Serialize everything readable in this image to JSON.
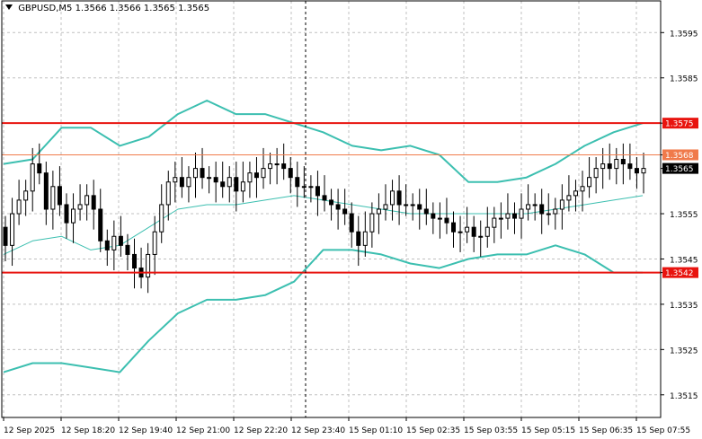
{
  "header": {
    "symbol": "GBPUSD,M5",
    "ohlc": "1.3566 1.3566 1.3565 1.3565"
  },
  "colors": {
    "background": "#ffffff",
    "grid": "#c0c0c0",
    "candle": "#000000",
    "band": "#3cbfb0",
    "level_red": "#e8130e",
    "level_orange": "#f07a4a",
    "price_label_bg": "#000000"
  },
  "icons": {
    "symbol_arrow": "triangle-down-icon"
  },
  "chart_data": {
    "type": "candlestick",
    "title": "GBPUSD,M5",
    "xlabel": "",
    "ylabel": "",
    "ylim": [
      1.351,
      1.3602
    ],
    "grid": true,
    "y_ticks": [
      "1.3595",
      "1.3585",
      "1.3575",
      "1.3568",
      "1.3565",
      "1.3555",
      "1.3545",
      "1.3542",
      "1.3535",
      "1.3525",
      "1.3515"
    ],
    "x_ticks": [
      "12 Sep 2025",
      "12 Sep 18:20",
      "12 Sep 19:40",
      "12 Sep 21:00",
      "12 Sep 22:20",
      "12 Sep 23:40",
      "15 Sep 01:10",
      "15 Sep 02:35",
      "15 Sep 03:55",
      "15 Sep 05:15",
      "15 Sep 06:35",
      "15 Sep 07:55"
    ],
    "levels": [
      {
        "value": 1.3575,
        "label": "1.3575",
        "color": "#e8130e"
      },
      {
        "value": 1.3568,
        "label": "1.3568",
        "color": "#f07a4a"
      },
      {
        "value": 1.3542,
        "label": "1.3542",
        "color": "#e8130e"
      }
    ],
    "current_price": {
      "value": 1.3565,
      "label": "1.3565"
    },
    "closes": [
      1.3548,
      1.3555,
      1.3558,
      1.356,
      1.3566,
      1.3564,
      1.3556,
      1.3561,
      1.3557,
      1.3553,
      1.3556,
      1.3557,
      1.3559,
      1.3556,
      1.3549,
      1.3547,
      1.355,
      1.3548,
      1.3546,
      1.3543,
      1.3541,
      1.3546,
      1.3551,
      1.3557,
      1.3562,
      1.3563,
      1.3561,
      1.3563,
      1.3565,
      1.3563,
      1.3563,
      1.3562,
      1.3561,
      1.3563,
      1.356,
      1.3562,
      1.3564,
      1.3563,
      1.3565,
      1.3566,
      1.3566,
      1.3565,
      1.3563,
      1.3561,
      1.3561,
      1.3561,
      1.3559,
      1.3558,
      1.3557,
      1.3556,
      1.3555,
      1.3551,
      1.3548,
      1.3551,
      1.3555,
      1.3556,
      1.3557,
      1.356,
      1.3557,
      1.3557,
      1.3557,
      1.3556,
      1.3555,
      1.3554,
      1.3554,
      1.3553,
      1.3551,
      1.3551,
      1.3552,
      1.355,
      1.355,
      1.3552,
      1.3554,
      1.3554,
      1.3555,
      1.3554,
      1.3556,
      1.3557,
      1.3557,
      1.3555,
      1.3555,
      1.3556,
      1.3558,
      1.3559,
      1.356,
      1.3561,
      1.3563,
      1.3565,
      1.3566,
      1.3565,
      1.3567,
      1.3566,
      1.3565,
      1.3564,
      1.3565
    ],
    "series": [
      {
        "name": "",
        "values": [
          1.3566,
          1.3567,
          1.3574,
          1.3574,
          1.357,
          1.3572,
          1.3577,
          1.358,
          1.3577,
          1.3577,
          1.3575,
          1.3573,
          1.357,
          1.3569,
          1.357,
          1.3568,
          1.3562,
          1.3562,
          1.3563,
          1.3566,
          1.357,
          1.3573,
          1.3575
        ]
      },
      {
        "name": "",
        "values": [
          1.3546,
          1.3549,
          1.355,
          1.3547,
          1.3548,
          1.3552,
          1.3556,
          1.3557,
          1.3557,
          1.3558,
          1.3559,
          1.3558,
          1.3557,
          1.3556,
          1.3555,
          1.3555,
          1.3555,
          1.3555,
          1.3555,
          1.3556,
          1.3557,
          1.3558,
          1.3559
        ]
      },
      {
        "name": "",
        "values": [
          1.352,
          1.3522,
          1.3522,
          1.3521,
          1.352,
          1.3527,
          1.3533,
          1.3536,
          1.3536,
          1.3537,
          1.354,
          1.3547,
          1.3547,
          1.3546,
          1.3544,
          1.3543,
          1.3545,
          1.3546,
          1.3546,
          1.3548,
          1.3546,
          1.3542,
          1.3542
        ]
      }
    ]
  }
}
